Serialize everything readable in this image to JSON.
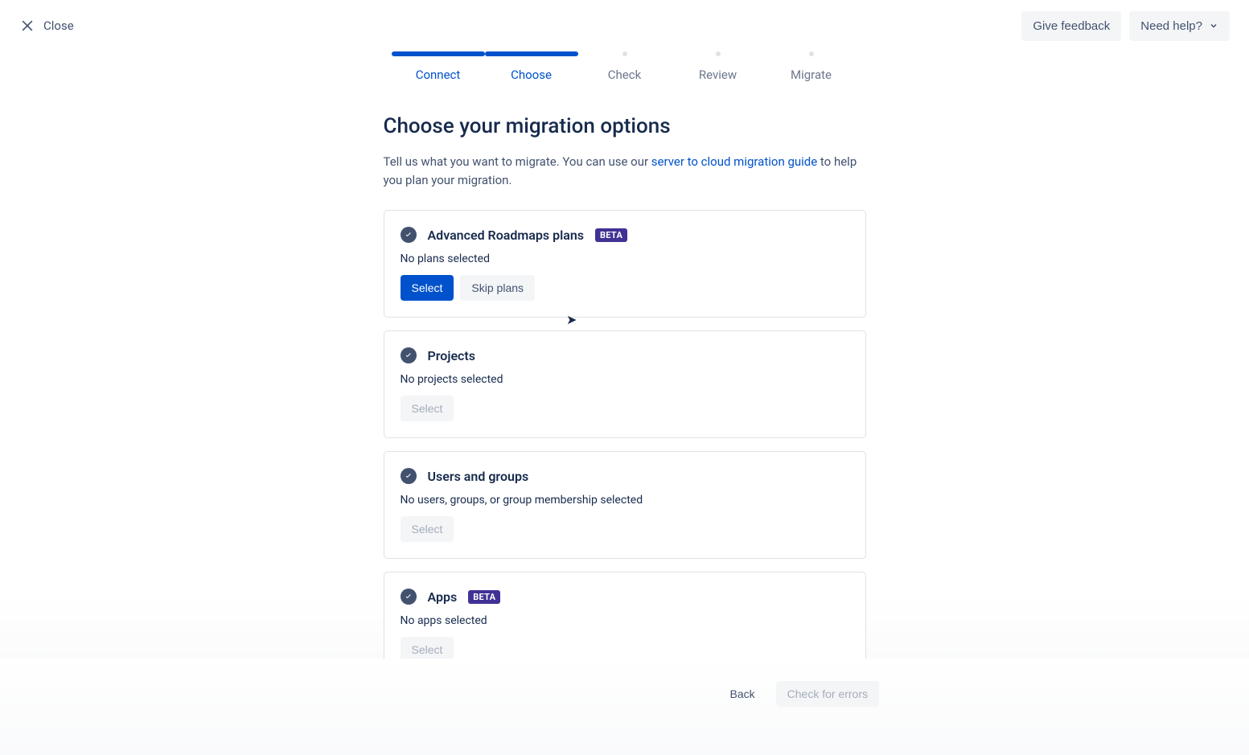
{
  "header": {
    "close": "Close",
    "give_feedback": "Give feedback",
    "need_help": "Need help?"
  },
  "stepper": {
    "steps": [
      "Connect",
      "Choose",
      "Check",
      "Review",
      "Migrate"
    ],
    "current_index": 1
  },
  "page": {
    "title": "Choose your migration options",
    "desc_1": "Tell us what you want to migrate. You can use our ",
    "desc_link": "server to cloud migration guide",
    "desc_2": " to help you plan your migration."
  },
  "cards": {
    "roadmaps": {
      "title": "Advanced Roadmaps plans",
      "beta": "BETA",
      "status": "No plans selected",
      "select": "Select",
      "skip": "Skip plans"
    },
    "projects": {
      "title": "Projects",
      "status": "No projects selected",
      "select": "Select"
    },
    "users": {
      "title": "Users and groups",
      "status": "No users, groups, or group membership selected",
      "select": "Select"
    },
    "apps": {
      "title": "Apps",
      "beta": "BETA",
      "status": "No apps selected",
      "select": "Select"
    }
  },
  "footer": {
    "back": "Back",
    "check_errors": "Check for errors"
  }
}
